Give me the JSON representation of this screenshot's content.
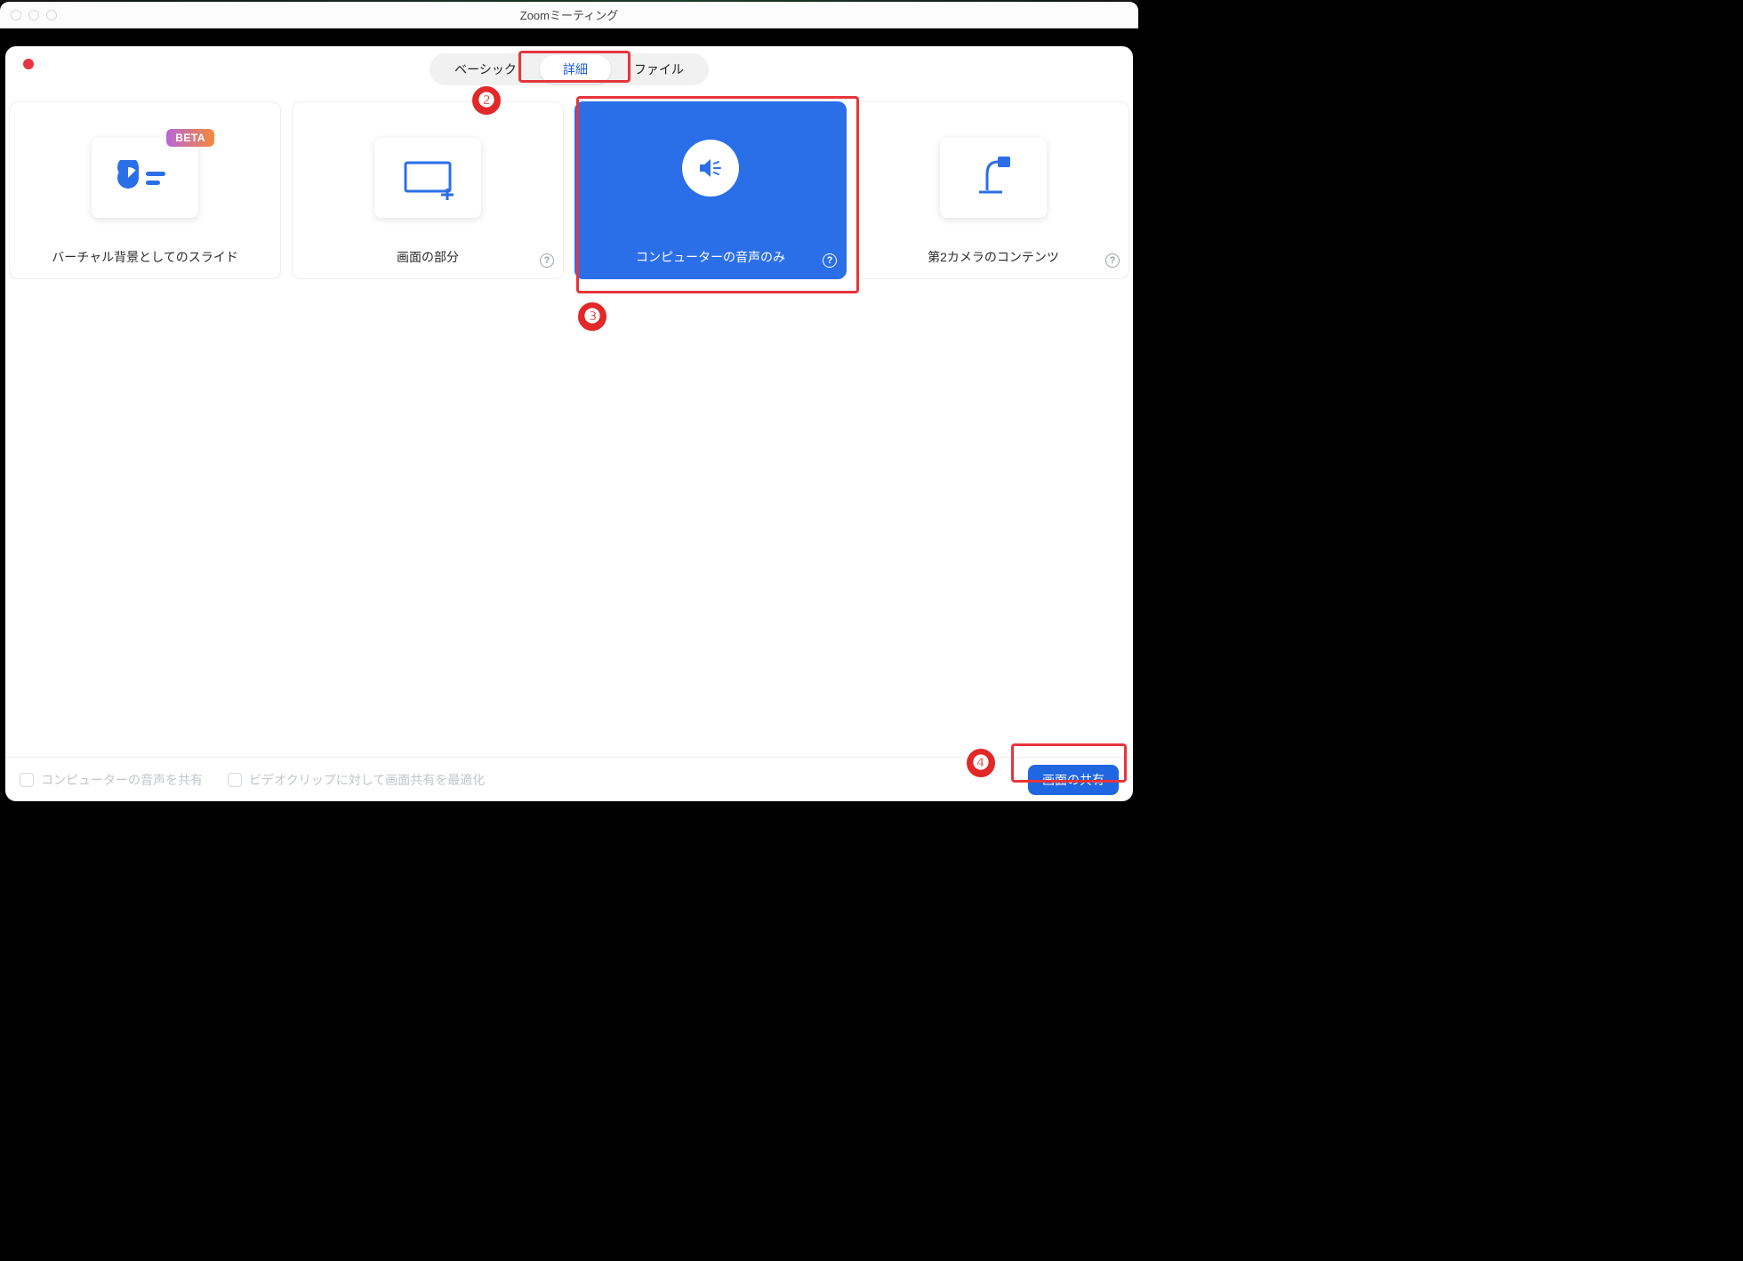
{
  "window": {
    "title": "Zoomミーティング"
  },
  "tabs": {
    "basic": "ベーシック",
    "advanced": "詳細",
    "file": "ファイル"
  },
  "cards": {
    "slides": {
      "label": "バーチャル背景としてのスライド",
      "badge": "BETA"
    },
    "portion": {
      "label": "画面の部分"
    },
    "audio_only": {
      "label": "コンピューターの音声のみ"
    },
    "second_camera": {
      "label": "第2カメラのコンテンツ"
    }
  },
  "footer": {
    "share_audio": "コンピューターの音声を共有",
    "optimize_video": "ビデオクリップに対して画面共有を最適化",
    "share_button": "画面の共有"
  },
  "annotations": {
    "n2": "❷",
    "n3": "❸",
    "n4": "❹"
  },
  "help_glyph": "?"
}
